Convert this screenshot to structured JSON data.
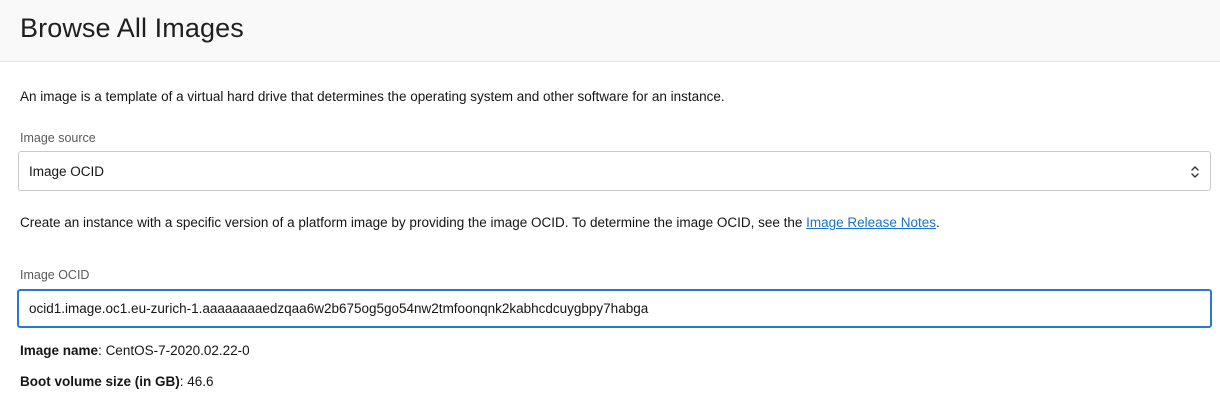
{
  "page": {
    "title": "Browse All Images",
    "description": "An image is a template of a virtual hard drive that determines the operating system and other software for an instance."
  },
  "image_source": {
    "label": "Image source",
    "selected": "Image OCID"
  },
  "help": {
    "text": "Create an instance with a specific version of a platform image by providing the image OCID. To determine the image OCID, see the ",
    "link_text": "Image Release Notes",
    "suffix": "."
  },
  "image_ocid": {
    "label": "Image OCID",
    "value": "ocid1.image.oc1.eu-zurich-1.aaaaaaaaedzqaa6w2b675og5go54nw2tmfoonqnk2kabhcdcuygbpy7habga"
  },
  "details": {
    "name_label": "Image name",
    "name_value": "CentOS-7-2020.02.22-0",
    "boot_label": "Boot volume size (in GB)",
    "boot_value": "46.6"
  },
  "colors": {
    "link": "#1a73c9",
    "focus_border": "#2a78d4",
    "header_bg": "#f9f9f9"
  },
  "icons": {
    "select_chevron": "chevron-up-down-icon"
  }
}
